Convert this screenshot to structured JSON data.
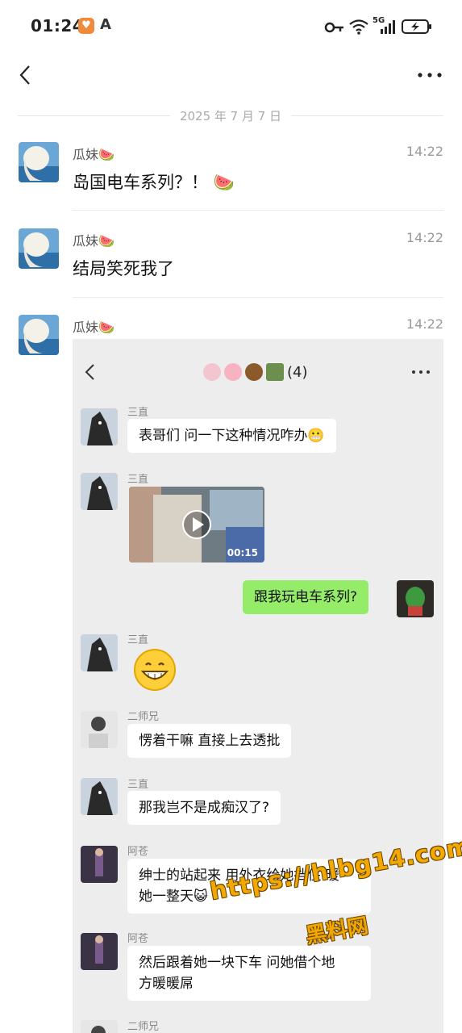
{
  "status_bar": {
    "time": "01:24",
    "network": "5G"
  },
  "date_divider": "2025 年 7 月 7 日",
  "messages": [
    {
      "sender": "瓜妹🍉",
      "time": "14:22",
      "text": "岛国电车系列？！ 🍉"
    },
    {
      "sender": "瓜妹🍉",
      "time": "14:22",
      "text": "结局笑死我了"
    },
    {
      "sender": "瓜妹🍉",
      "time": "14:22",
      "text": ""
    }
  ],
  "inner_chat": {
    "title_count": "(4)",
    "messages": [
      {
        "sender": "三直",
        "text": "表哥们 问一下这种情况咋办😬"
      },
      {
        "sender": "三直",
        "video_duration": "00:15"
      },
      {
        "self": true,
        "text": "跟我玩电车系列?"
      },
      {
        "sender": "三直",
        "sticker": "grinning-face"
      },
      {
        "sender": "二师兄",
        "text": "愣着干嘛 直接上去透批"
      },
      {
        "sender": "三直",
        "text": "那我岂不是成痴汉了?"
      },
      {
        "sender": "阿苍",
        "text_line1": "绅士的站起来 用外衣给她挡住 暖",
        "text_line2": "她一整天😺"
      },
      {
        "sender": "阿苍",
        "text_line1": "然后跟着她一块下车 问她借个地",
        "text_line2": "方暖暖屌"
      },
      {
        "sender": "二师兄"
      }
    ]
  },
  "watermark": {
    "url": "https://hlbg14.com",
    "label": "黑料网"
  },
  "colors": {
    "green_bubble": "#95ec69",
    "chat_bg": "#ededed",
    "watermark": "#f2a800"
  }
}
